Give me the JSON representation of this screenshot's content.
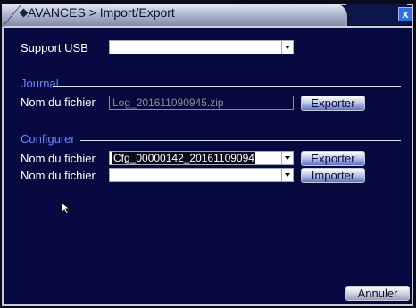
{
  "window": {
    "title": "AVANCES > Import/Export",
    "close_label": "x"
  },
  "usb": {
    "label": "Support USB",
    "selected": ""
  },
  "journal": {
    "section_label": "Journal",
    "file_label": "Nom du fichier",
    "file_value": "Log_201611090945.zip",
    "export_label": "Exporter"
  },
  "config": {
    "section_label": "Configurer",
    "export_file_label": "Nom du fichier",
    "export_file_value": "Cfg_00000142_20161109094",
    "export_label": "Exporter",
    "import_file_label": "Nom du fichier",
    "import_file_value": "",
    "import_label": "Importer"
  },
  "footer": {
    "cancel_label": "Annuler"
  }
}
